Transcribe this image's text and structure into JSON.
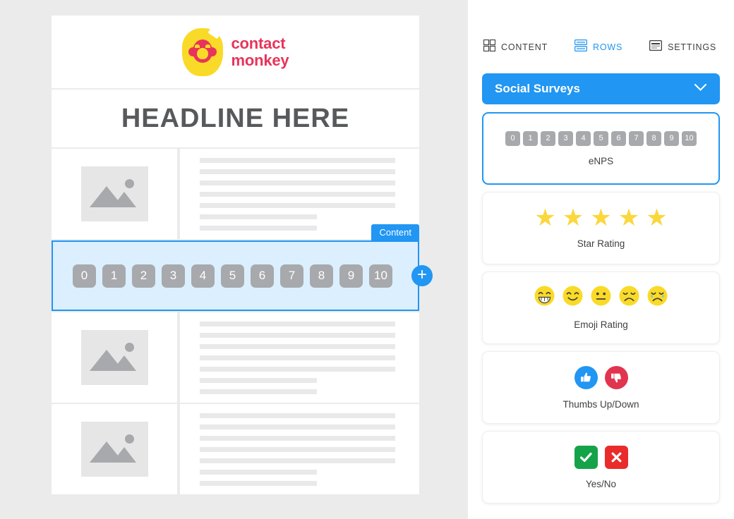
{
  "editor": {
    "logo": {
      "icon": "contactmonkey-monkey-logo",
      "line1": "contact",
      "line2": "monkey",
      "brand_color": "#e8345a",
      "blob_color": "#fada28"
    },
    "headline": "HEADLINE HERE",
    "selected_row": {
      "badge": "Content",
      "scale": [
        "0",
        "1",
        "2",
        "3",
        "4",
        "5",
        "6",
        "7",
        "8",
        "9",
        "10"
      ],
      "add_button": "+",
      "selection_color": "#2196f3",
      "selection_fill": "#dcefff"
    },
    "content_rows": [
      {
        "image_icon": "image-placeholder-icon",
        "text_lines": [
          100,
          100,
          100,
          100,
          100,
          60,
          60
        ]
      },
      {
        "image_icon": "image-placeholder-icon",
        "text_lines": [
          100,
          100,
          100,
          100,
          100,
          60,
          60
        ]
      },
      {
        "image_icon": "image-placeholder-icon",
        "text_lines": [
          100,
          100,
          100,
          100,
          100,
          60,
          60
        ]
      }
    ]
  },
  "inspector": {
    "tabs": [
      {
        "label": "CONTENT",
        "icon": "grid-icon",
        "active": false
      },
      {
        "label": "ROWS",
        "icon": "rows-icon",
        "active": true
      },
      {
        "label": "SETTINGS",
        "icon": "settings-icon",
        "active": false
      }
    ],
    "section": {
      "title": "Social Surveys",
      "chevron": "chevron-down-icon",
      "expanded": true,
      "header_color": "#2196f3"
    },
    "cards": [
      {
        "label": "eNPS",
        "kind": "scale",
        "selected": true,
        "scale": [
          "0",
          "1",
          "2",
          "3",
          "4",
          "5",
          "6",
          "7",
          "8",
          "9",
          "10"
        ]
      },
      {
        "label": "Star Rating",
        "kind": "stars",
        "selected": false,
        "star_count": 5,
        "star_glyph": "★",
        "star_color": "#fbd73c"
      },
      {
        "label": "Emoji Rating",
        "kind": "emojis",
        "selected": false,
        "emoji_faces": [
          "grinning-face",
          "smiling-face",
          "neutral-face",
          "sad-face",
          "crying-face"
        ],
        "emoji_color": "#fada28"
      },
      {
        "label": "Thumbs Up/Down",
        "kind": "thumbs",
        "selected": false,
        "icons": [
          "thumbs-up-icon",
          "thumbs-down-icon"
        ],
        "up_color": "#2196f3",
        "down_color": "#e0344f"
      },
      {
        "label": "Yes/No",
        "kind": "yesno",
        "selected": false,
        "icons": [
          "checkmark-icon",
          "cross-icon"
        ],
        "yes_color": "#15a34a",
        "no_color": "#e92b2b"
      }
    ]
  }
}
